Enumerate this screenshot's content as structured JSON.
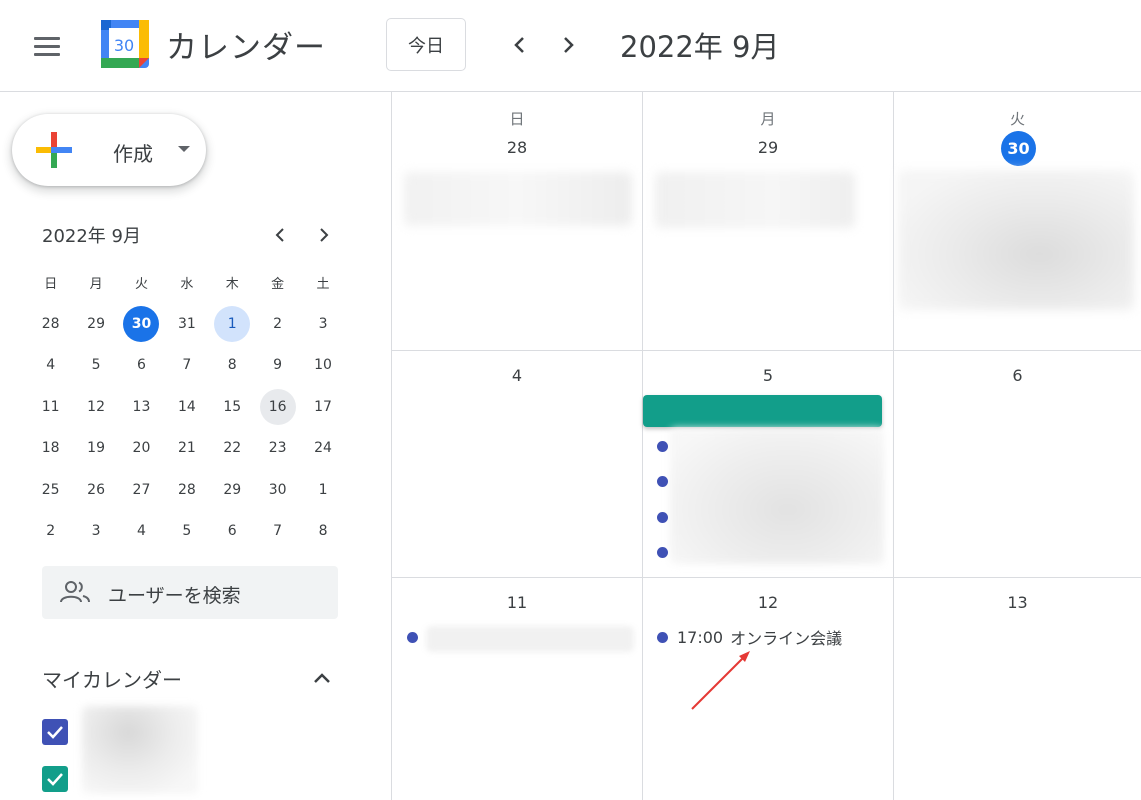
{
  "header": {
    "menu_icon": "hamburger-menu-icon",
    "logo_day": "30",
    "app_title": "カレンダー",
    "today_label": "今日",
    "month_title": "2022年 9月"
  },
  "sidebar": {
    "create_label": "作成",
    "mini_calendar": {
      "title": "2022年 9月",
      "weekdays": [
        "日",
        "月",
        "火",
        "水",
        "木",
        "金",
        "土"
      ],
      "weeks": [
        [
          "28",
          "29",
          "30",
          "31",
          "1",
          "2",
          "3"
        ],
        [
          "4",
          "5",
          "6",
          "7",
          "8",
          "9",
          "10"
        ],
        [
          "11",
          "12",
          "13",
          "14",
          "15",
          "16",
          "17"
        ],
        [
          "18",
          "19",
          "20",
          "21",
          "22",
          "23",
          "24"
        ],
        [
          "25",
          "26",
          "27",
          "28",
          "29",
          "30",
          "1"
        ],
        [
          "2",
          "3",
          "4",
          "5",
          "6",
          "7",
          "8"
        ]
      ],
      "today": "30",
      "selected": "1",
      "hovered": "16"
    },
    "search_users_label": "ユーザーを検索",
    "my_calendars_title": "マイカレンダー",
    "calendar_colors": [
      "#3f51b5",
      "#129e8a"
    ]
  },
  "month_grid": {
    "weekday_heads": [
      "日",
      "月",
      "火"
    ],
    "row1_days": [
      "28",
      "29",
      "30"
    ],
    "row2_days": [
      "4",
      "5",
      "6"
    ],
    "row3_days": [
      "11",
      "12",
      "13"
    ],
    "event": {
      "time": "17:00",
      "title": "オンライン会議"
    },
    "colors": {
      "today": "#1a73e8",
      "event_bar": "#129e8a",
      "dot": "#3f51b5",
      "arrow": "#e53935"
    }
  }
}
